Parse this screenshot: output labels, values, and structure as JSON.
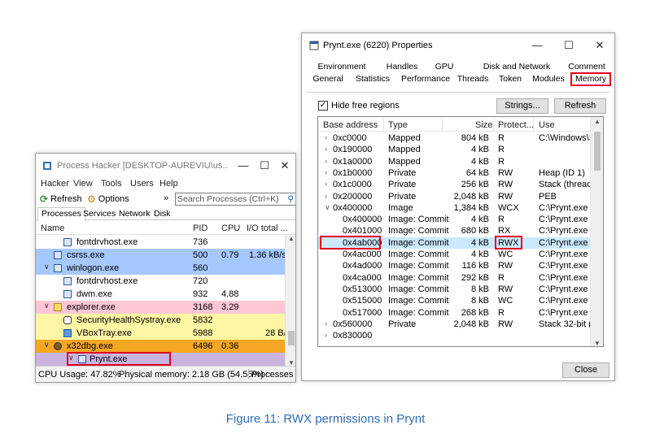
{
  "process_hacker": {
    "title": "Process Hacker [DESKTOP-AUREVIU\\us...",
    "menu": [
      "Hacker",
      "View",
      "Tools",
      "Users",
      "Help"
    ],
    "toolbar": {
      "refresh": "Refresh",
      "options": "Options",
      "more": "»"
    },
    "search_placeholder": "Search Processes (Ctrl+K)",
    "tabs": [
      "Processes",
      "Services",
      "Network",
      "Disk"
    ],
    "columns": [
      "Name",
      "PID",
      "CPU",
      "I/O total ..."
    ],
    "rows": [
      {
        "name": "fontdrvhost.exe",
        "pid": "736",
        "cpu": "",
        "io": ""
      },
      {
        "name": "csrss.exe",
        "pid": "500",
        "cpu": "0.79",
        "io": "1.36 kB/s"
      },
      {
        "name": "winlogon.exe",
        "pid": "560",
        "cpu": "",
        "io": ""
      },
      {
        "name": "fontdrvhost.exe",
        "pid": "720",
        "cpu": "",
        "io": ""
      },
      {
        "name": "dwm.exe",
        "pid": "932",
        "cpu": "4.88",
        "io": ""
      },
      {
        "name": "explorer.exe",
        "pid": "3168",
        "cpu": "3.29",
        "io": ""
      },
      {
        "name": "SecurityHealthSystray.exe",
        "pid": "5832",
        "cpu": "",
        "io": ""
      },
      {
        "name": "VBoxTray.exe",
        "pid": "5988",
        "cpu": "",
        "io": "28 B/"
      },
      {
        "name": "x32dbg.exe",
        "pid": "6496",
        "cpu": "0.36",
        "io": ""
      },
      {
        "name": "Prynt.exe",
        "pid": "",
        "cpu": "",
        "io": ""
      }
    ],
    "status": {
      "cpu": "CPU Usage: 47.82%",
      "memory": "Physical memory: 2.18 GB (54.55%)",
      "processes": "Processes"
    }
  },
  "properties": {
    "title": "Prynt.exe (6220) Properties",
    "tabs_top": [
      "Environment",
      "Handles",
      "GPU",
      "Disk and Network",
      "Comment"
    ],
    "tabs_bottom": [
      "General",
      "Statistics",
      "Performance",
      "Threads",
      "Token",
      "Modules",
      "Memory"
    ],
    "hide_free_regions": "Hide free regions",
    "strings_button": "Strings...",
    "refresh_button": "Refresh",
    "columns": [
      "Base address",
      "Type",
      "Size",
      "Protect...",
      "Use"
    ],
    "rows": [
      {
        "addr": "0xc0000",
        "type": "Mapped",
        "size": "804 kB",
        "prot": "R",
        "use": "C:\\Windows\\Sys"
      },
      {
        "addr": "0x190000",
        "type": "Mapped",
        "size": "4 kB",
        "prot": "R",
        "use": ""
      },
      {
        "addr": "0x1a0000",
        "type": "Mapped",
        "size": "4 kB",
        "prot": "R",
        "use": ""
      },
      {
        "addr": "0x1b0000",
        "type": "Private",
        "size": "64 kB",
        "prot": "RW",
        "use": "Heap (ID 1)"
      },
      {
        "addr": "0x1c0000",
        "type": "Private",
        "size": "256 kB",
        "prot": "RW",
        "use": "Stack (thread 3"
      },
      {
        "addr": "0x200000",
        "type": "Private",
        "size": "2,048 kB",
        "prot": "RW",
        "use": "PEB"
      },
      {
        "addr": "0x400000",
        "type": "Image",
        "size": "1,384 kB",
        "prot": "WCX",
        "use": "C:\\Prynt.exe"
      },
      {
        "addr": "0x400000",
        "type": "Image: Commit",
        "size": "4 kB",
        "prot": "R",
        "use": "C:\\Prynt.exe"
      },
      {
        "addr": "0x401000",
        "type": "Image: Commit",
        "size": "680 kB",
        "prot": "RX",
        "use": "C:\\Prynt.exe"
      },
      {
        "addr": "0x4ab000",
        "type": "Image: Commit",
        "size": "4 kB",
        "prot": "RWX",
        "use": "C:\\Prynt.exe"
      },
      {
        "addr": "0x4ac000",
        "type": "Image: Commit",
        "size": "4 kB",
        "prot": "WC",
        "use": "C:\\Prynt.exe"
      },
      {
        "addr": "0x4ad000",
        "type": "Image: Commit",
        "size": "116 kB",
        "prot": "RW",
        "use": "C:\\Prynt.exe"
      },
      {
        "addr": "0x4ca000",
        "type": "Image: Commit",
        "size": "292 kB",
        "prot": "R",
        "use": "C:\\Prynt.exe"
      },
      {
        "addr": "0x513000",
        "type": "Image: Commit",
        "size": "8 kB",
        "prot": "RW",
        "use": "C:\\Prynt.exe"
      },
      {
        "addr": "0x515000",
        "type": "Image: Commit",
        "size": "8 kB",
        "prot": "WC",
        "use": "C:\\Prynt.exe"
      },
      {
        "addr": "0x517000",
        "type": "Image: Commit",
        "size": "268 kB",
        "prot": "R",
        "use": "C:\\Prynt.exe"
      },
      {
        "addr": "0x560000",
        "type": "Private",
        "size": "2,048 kB",
        "prot": "RW",
        "use": "Stack 32-bit (thr"
      },
      {
        "addr": "0x830000",
        "type": "",
        "size": "",
        "prot": "",
        "use": ""
      }
    ],
    "close_button": "Close"
  },
  "caption": "Figure 11: RWX permissions in Prynt",
  "colors": {
    "system_row": "#a6c8ff",
    "user_row": "#ffc6d4",
    "service_row": "#fff6a5",
    "debugger_row": "#f5a623",
    "selected_row": "#cce8ff",
    "highlight_box": "#e0001b",
    "caption": "#2f6db5"
  }
}
